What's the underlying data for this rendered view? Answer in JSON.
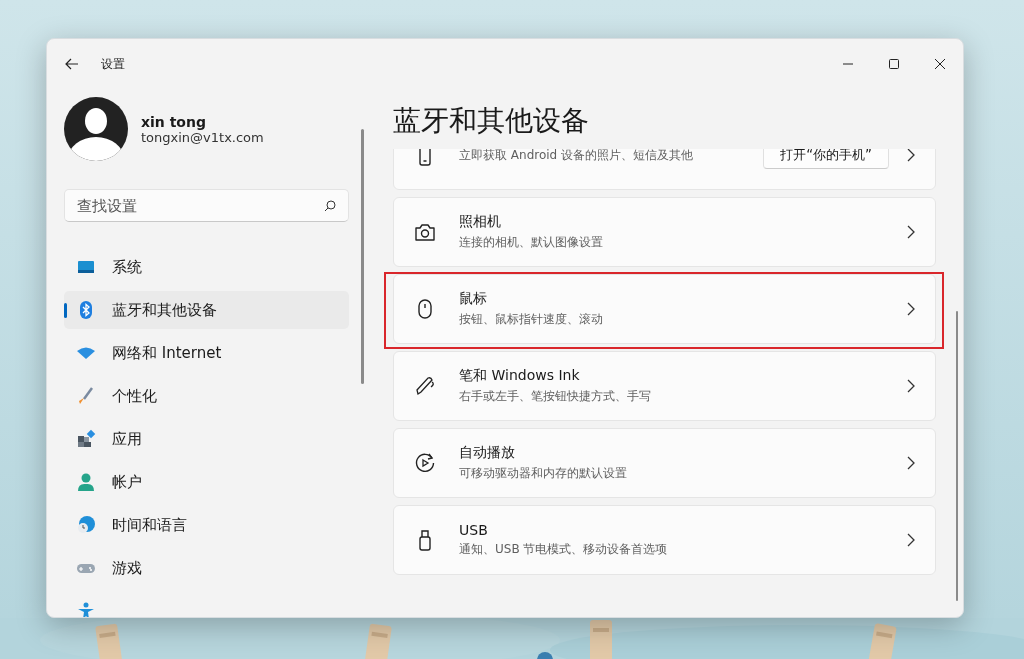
{
  "window": {
    "title": "设置"
  },
  "user": {
    "name": "xin tong",
    "email": "tongxin@v1tx.com"
  },
  "search": {
    "placeholder": "查找设置"
  },
  "nav": [
    {
      "kind": "system",
      "label": "系统",
      "selected": false
    },
    {
      "kind": "bluetooth",
      "label": "蓝牙和其他设备",
      "selected": true
    },
    {
      "kind": "network",
      "label": "网络和 Internet",
      "selected": false
    },
    {
      "kind": "personalization",
      "label": "个性化",
      "selected": false
    },
    {
      "kind": "apps",
      "label": "应用",
      "selected": false
    },
    {
      "kind": "accounts",
      "label": "帐户",
      "selected": false
    },
    {
      "kind": "time",
      "label": "时间和语言",
      "selected": false
    },
    {
      "kind": "gaming",
      "label": "游戏",
      "selected": false
    },
    {
      "kind": "accessibility",
      "selected": false
    }
  ],
  "page_title": "蓝牙和其他设备",
  "cards": [
    {
      "kind": "phone",
      "subtitle": "立即获取 Android 设备的照片、短信及其他",
      "button": "打开“你的手机”",
      "highlighted": false
    },
    {
      "kind": "camera",
      "title": "照相机",
      "subtitle": "连接的相机、默认图像设置",
      "highlighted": false
    },
    {
      "kind": "mouse",
      "title": "鼠标",
      "subtitle": "按钮、鼠标指针速度、滚动",
      "highlighted": true
    },
    {
      "kind": "pen",
      "title": "笔和 Windows Ink",
      "subtitle": "右手或左手、笔按钮快捷方式、手写",
      "highlighted": false
    },
    {
      "kind": "autoplay",
      "title": "自动播放",
      "subtitle": "可移动驱动器和内存的默认设置",
      "highlighted": false
    },
    {
      "kind": "usb",
      "title": "USB",
      "subtitle": "通知、USB 节电模式、移动设备首选项",
      "highlighted": false
    }
  ]
}
